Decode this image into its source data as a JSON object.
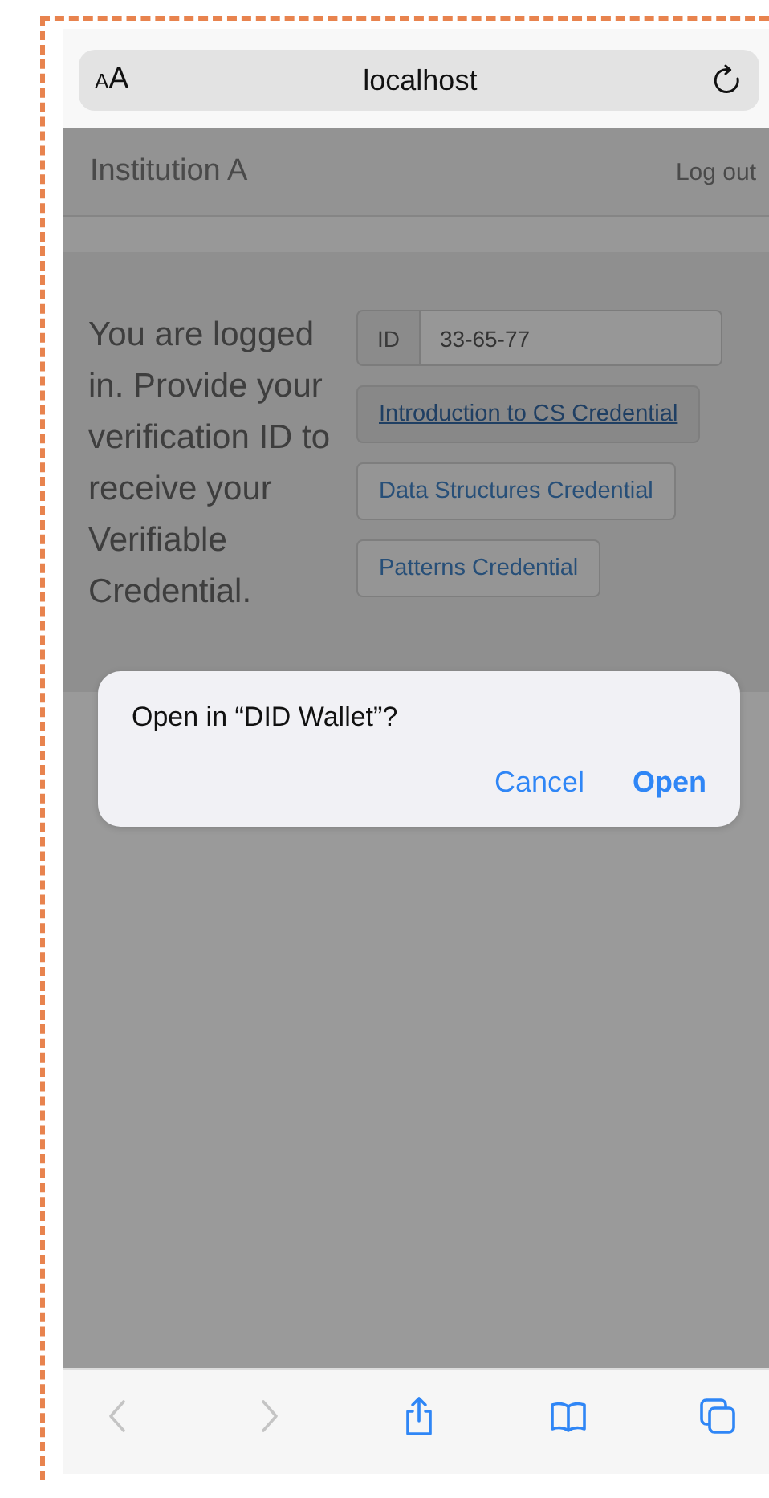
{
  "browser": {
    "text_size_label": "AA",
    "address": "localhost"
  },
  "site": {
    "title": "Institution A",
    "logout": "Log out"
  },
  "message": "You are logged in. Provide your verification ID to receive your Verifiable Credential.",
  "id_field": {
    "label": "ID",
    "value": "33-65-77"
  },
  "credentials": [
    {
      "label": "Introduction to CS Credential",
      "focused": true
    },
    {
      "label": "Data Structures Credential",
      "focused": false
    },
    {
      "label": "Patterns Credential",
      "focused": false
    }
  ],
  "dialog": {
    "title": "Open in “DID Wallet”?",
    "buttons": [
      {
        "label": "Cancel",
        "kind": "secondary"
      },
      {
        "label": "Open",
        "kind": "primary"
      }
    ]
  },
  "toolbar": [
    {
      "kind": "back",
      "disabled": true
    },
    {
      "kind": "forward",
      "disabled": true
    },
    {
      "kind": "share",
      "disabled": false
    },
    {
      "kind": "bookmarks",
      "disabled": false
    },
    {
      "kind": "tabs",
      "disabled": false
    }
  ]
}
